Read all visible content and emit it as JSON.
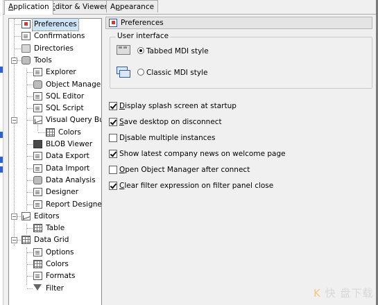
{
  "tabs": [
    {
      "label": "Application",
      "underline": "A",
      "active": true
    },
    {
      "label": "Editor & Viewers",
      "underline": "E",
      "active": false
    },
    {
      "label": "Appearance",
      "underline": "p",
      "active": false
    }
  ],
  "tree": [
    {
      "label": "Preferences",
      "icon": "preferences-icon",
      "selected": true
    },
    {
      "label": "Confirmations",
      "icon": "confirmations-icon"
    },
    {
      "label": "Directories",
      "icon": "directories-icon"
    },
    {
      "label": "Tools",
      "icon": "tools-icon",
      "expander": "−"
    },
    {
      "label": "Explorer",
      "icon": "explorer-icon"
    },
    {
      "label": "Object Manager",
      "icon": "object-manager-icon"
    },
    {
      "label": "SQL Editor",
      "icon": "sql-editor-icon"
    },
    {
      "label": "SQL Script",
      "icon": "sql-script-icon"
    },
    {
      "label": "Visual Query Build",
      "icon": "visual-query-builder-icon",
      "expander": "−"
    },
    {
      "label": "Colors",
      "icon": "colors-icon"
    },
    {
      "label": "BLOB Viewer",
      "icon": "blob-viewer-icon"
    },
    {
      "label": "Data Export",
      "icon": "data-export-icon"
    },
    {
      "label": "Data Import",
      "icon": "data-import-icon"
    },
    {
      "label": "Data Analysis",
      "icon": "data-analysis-icon"
    },
    {
      "label": "Designer",
      "icon": "designer-icon"
    },
    {
      "label": "Report Designer",
      "icon": "report-designer-icon"
    },
    {
      "label": "Editors",
      "icon": "editors-icon",
      "expander": "−"
    },
    {
      "label": "Table",
      "icon": "table-icon"
    },
    {
      "label": "Data Grid",
      "icon": "data-grid-icon",
      "expander": "−"
    },
    {
      "label": "Options",
      "icon": "options-icon"
    },
    {
      "label": "Colors",
      "icon": "colors-icon"
    },
    {
      "label": "Formats",
      "icon": "formats-icon"
    },
    {
      "label": "Filter",
      "icon": "filter-icon"
    }
  ],
  "header": {
    "title": "Preferences",
    "icon": "preferences-icon"
  },
  "user_interface": {
    "group_title": "User interface",
    "options": [
      {
        "label": "Tabbed MDI style",
        "selected": true,
        "icon": "tabbed-mdi-icon"
      },
      {
        "label": "Classic MDI style",
        "selected": false,
        "icon": "classic-mdi-icon"
      }
    ]
  },
  "checkboxes": [
    {
      "label": "Display splash screen at startup",
      "underline": "D",
      "checked": true
    },
    {
      "label": "Save desktop on disconnect",
      "underline": "S",
      "checked": true
    },
    {
      "label": "Disable multiple instances",
      "underline": "i",
      "checked": false
    },
    {
      "label": "Show latest company news on welcome page",
      "underline": "",
      "checked": true
    },
    {
      "label": "Open Object Manager after connect",
      "underline": "O",
      "checked": false
    },
    {
      "label": "Clear filter expression on filter panel close",
      "underline": "C",
      "checked": true
    }
  ],
  "watermark": {
    "brand_letter": "K",
    "text": "快 盘下载"
  }
}
